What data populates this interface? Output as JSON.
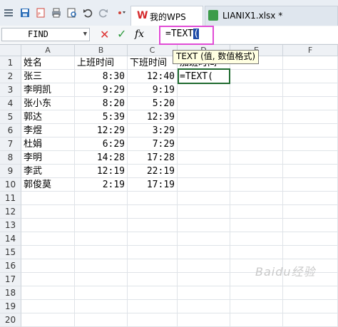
{
  "tabs": {
    "wps_label": "我的WPS",
    "file_label": "LIANIX1.xlsx *"
  },
  "formula_bar": {
    "name_box": "FIND",
    "formula": "=TEXT(",
    "fx_label": "fx"
  },
  "tooltip": "TEXT (值, 数值格式)",
  "columns": [
    "A",
    "B",
    "C",
    "D",
    "E",
    "F"
  ],
  "rows": [
    {
      "n": "1",
      "a": "姓名",
      "b": "上班时间",
      "c": "下班时间",
      "d": "加班时间"
    },
    {
      "n": "2",
      "a": "张三",
      "b": "8:30",
      "c": "12:40",
      "d": "=TEXT("
    },
    {
      "n": "3",
      "a": "李明凯",
      "b": "9:29",
      "c": "9:19",
      "d": ""
    },
    {
      "n": "4",
      "a": "张小东",
      "b": "8:20",
      "c": "5:20",
      "d": ""
    },
    {
      "n": "5",
      "a": "郭达",
      "b": "5:39",
      "c": "12:39",
      "d": ""
    },
    {
      "n": "6",
      "a": "李煜",
      "b": "12:29",
      "c": "3:29",
      "d": ""
    },
    {
      "n": "7",
      "a": "杜娟",
      "b": "6:29",
      "c": "7:29",
      "d": ""
    },
    {
      "n": "8",
      "a": "李明",
      "b": "14:28",
      "c": "17:28",
      "d": ""
    },
    {
      "n": "9",
      "a": "李武",
      "b": "12:19",
      "c": "22:19",
      "d": ""
    },
    {
      "n": "10",
      "a": "郭俊莫",
      "b": "2:19",
      "c": "17:19",
      "d": ""
    },
    {
      "n": "11",
      "a": "",
      "b": "",
      "c": "",
      "d": ""
    },
    {
      "n": "12",
      "a": "",
      "b": "",
      "c": "",
      "d": ""
    },
    {
      "n": "13",
      "a": "",
      "b": "",
      "c": "",
      "d": ""
    },
    {
      "n": "14",
      "a": "",
      "b": "",
      "c": "",
      "d": ""
    },
    {
      "n": "15",
      "a": "",
      "b": "",
      "c": "",
      "d": ""
    },
    {
      "n": "16",
      "a": "",
      "b": "",
      "c": "",
      "d": ""
    },
    {
      "n": "17",
      "a": "",
      "b": "",
      "c": "",
      "d": ""
    },
    {
      "n": "18",
      "a": "",
      "b": "",
      "c": "",
      "d": ""
    },
    {
      "n": "19",
      "a": "",
      "b": "",
      "c": "",
      "d": ""
    },
    {
      "n": "20",
      "a": "",
      "b": "",
      "c": "",
      "d": ""
    }
  ],
  "watermark": "Baidu经验",
  "colors": {
    "formula_highlight": "#e14bd6",
    "active_cell_border": "#1f6b2f",
    "cursor_bg": "#1e4aa8",
    "wps_red": "#d5282b"
  }
}
